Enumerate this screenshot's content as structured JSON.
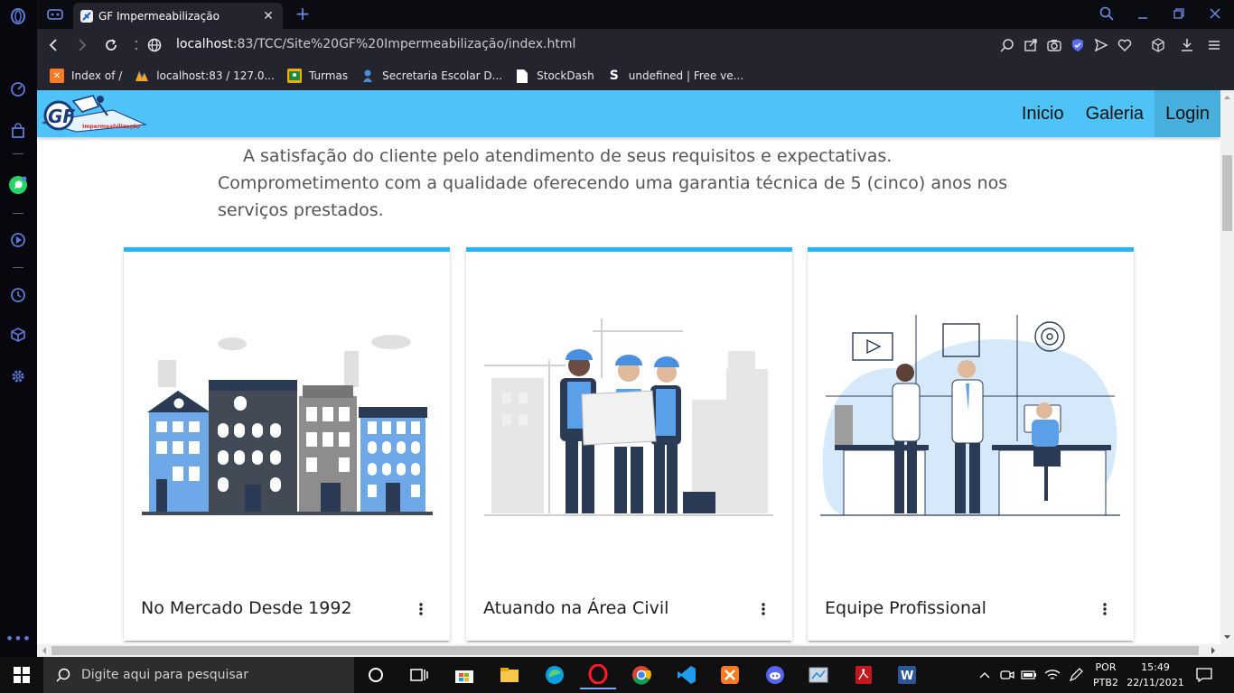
{
  "browser": {
    "tab_title": "GF Impermeabilização",
    "url_host": "localhost",
    "url_path": ":83/TCC/Site%20GF%20Impermeabilização/index.html"
  },
  "bookmarks": [
    {
      "label": "Index of /",
      "icon": "xampp-icon",
      "color": "#fb7a24"
    },
    {
      "label": "localhost:83 / 127.0...",
      "icon": "phpmyadmin-icon",
      "color": "#f5a623"
    },
    {
      "label": "Turmas",
      "icon": "classroom-icon",
      "color": "#f9ab00"
    },
    {
      "label": "Secretaria Escolar D...",
      "icon": "school-icon",
      "color": "#4a90d9"
    },
    {
      "label": "StockDash",
      "icon": "document-icon",
      "color": "#ffffff"
    },
    {
      "label": "undefined | Free ve...",
      "icon": "s-icon",
      "color": "#ffffff"
    }
  ],
  "site": {
    "logo_text": "GF",
    "logo_sub": "Impermeabilização",
    "nav": [
      "Inicio",
      "Galeria",
      "Login"
    ],
    "intro_line1": "A satisfação do cliente pelo atendimento de seus requisitos e expectativas.",
    "intro_line2": "Comprometimento com a qualidade oferecendo uma garantia técnica de 5 (cinco) anos nos serviços prestados.",
    "cards": [
      {
        "title": "No Mercado Desde 1992",
        "image": "buildings-illustration"
      },
      {
        "title": "Atuando na Área Civil",
        "image": "engineers-illustration"
      },
      {
        "title": "Equipe Profissional",
        "image": "office-team-illustration"
      }
    ],
    "accent": "#4fc3f7",
    "card_border": "#29b6f6"
  },
  "taskbar": {
    "search_placeholder": "Digite aqui para pesquisar",
    "lang_top": "POR",
    "lang_bottom": "PTB2",
    "time": "15:49",
    "date": "22/11/2021"
  }
}
